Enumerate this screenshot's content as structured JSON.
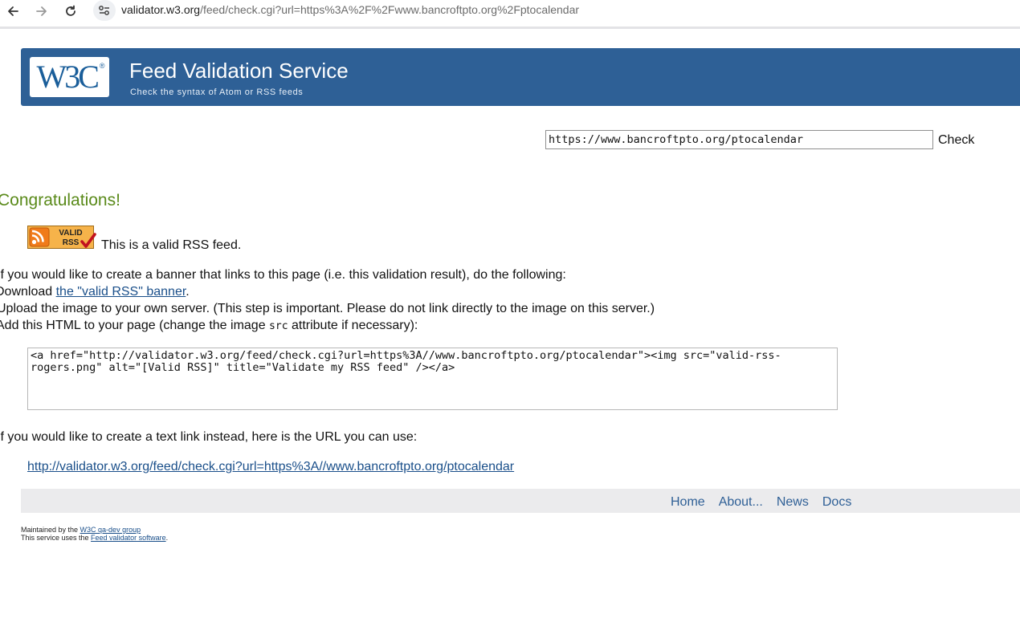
{
  "browser": {
    "url_host": "validator.w3.org",
    "url_path": "/feed/check.cgi?url=https%3A%2F%2Fwww.bancroftpto.org%2Fptocalendar"
  },
  "header": {
    "logo": "W3C",
    "title": "Feed Validation Service",
    "subtitle": "Check the syntax of Atom or RSS feeds"
  },
  "form": {
    "url_value": "https://www.bancroftpto.org/ptocalendar",
    "check_label": "Check"
  },
  "result": {
    "heading": "Congratulations!",
    "badge_line1": "VALID",
    "badge_line2": "RSS",
    "valid_text": "This is a valid RSS feed.",
    "banner_intro": "If you would like to create a banner that links to this page (i.e. this validation result), do the following:",
    "step1_prefix": "Download ",
    "step1_link": "the \"valid RSS\" banner",
    "step1_suffix": ".",
    "step2": "Upload the image to your own server. (This step is important. Please do not link directly to the image on this server.)",
    "step3_prefix": "Add this HTML to your page (change the image ",
    "step3_code": "src",
    "step3_suffix": " attribute if necessary):",
    "html_snippet": "<a href=\"http://validator.w3.org/feed/check.cgi?url=https%3A//www.bancroftpto.org/ptocalendar\"><img src=\"valid-rss-rogers.png\" alt=\"[Valid RSS]\" title=\"Validate my RSS feed\" /></a>",
    "text_link_intro": "If you would like to create a text link instead, here is the URL you can use:",
    "text_link_url": "http://validator.w3.org/feed/check.cgi?url=https%3A//www.bancroftpto.org/ptocalendar"
  },
  "footer": {
    "nav": [
      "Home",
      "About...",
      "News",
      "Docs"
    ],
    "maintained_prefix": "Maintained by the ",
    "maintained_link": "W3C qa-dev group",
    "software_prefix": "This service uses the ",
    "software_link": "Feed validator software",
    "software_suffix": "."
  },
  "colors": {
    "banner_blue": "#2e6096",
    "congrats_green": "#5a8a1a",
    "link_blue": "#1a4f8a"
  }
}
